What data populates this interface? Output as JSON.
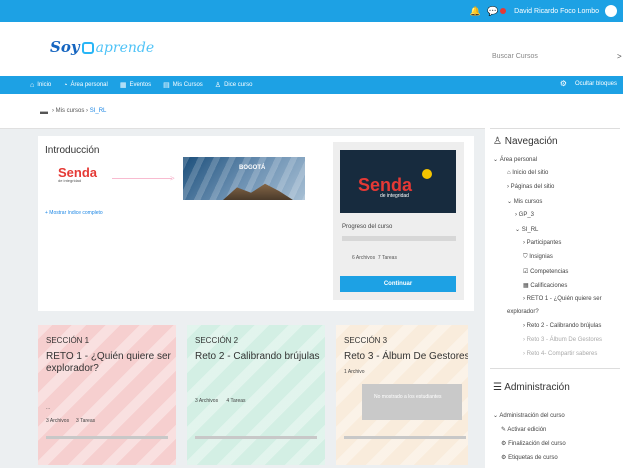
{
  "topbar": {
    "bell_icon": "bell-icon",
    "chat_icon": "chat-icon",
    "user_name": "David Ricardo Foco Lombo"
  },
  "header": {
    "logo_main": "Soy",
    "logo_sub": "aprende",
    "search_placeholder": "Buscar Cursos"
  },
  "nav": {
    "items": [
      "Inicio",
      "Área personal",
      "Eventos",
      "Mis Cursos",
      "Dice curso"
    ],
    "hide_blocks": "Ocultar bloques"
  },
  "breadcrumb": {
    "item1": "Mis cursos",
    "item2": "SI_RL"
  },
  "intro": {
    "title": "Introducción",
    "logo_text": "Senda",
    "logo_tag": "de integridad",
    "banner_text": "BOGOTÁ",
    "show_index": "+ Mostrar índice completo"
  },
  "course_card": {
    "logo_text": "Senda",
    "logo_tag": "de integridad",
    "progress_label": "Progreso del curso",
    "progress": 0.0,
    "files": "6 Archivos",
    "tasks": "7 Tareas",
    "continue": "Continuar"
  },
  "sections": [
    {
      "label": "SECCIÓN 1",
      "name": "RETO 1 - ¿Quién quiere ser explorador?",
      "files": "3 Archivos",
      "tasks": "3 Tareas",
      "dots": "..."
    },
    {
      "label": "SECCIÓN 2",
      "name": "Reto 2 - Calibrando brújulas",
      "files": "3 Archivos",
      "tasks": "4 Tareas"
    },
    {
      "label": "SECCIÓN 3",
      "name": "Reto 3 - Álbum De Gestores",
      "files": "1 Archivo",
      "hidden": "No mostrado a los estudiantes"
    }
  ],
  "navigation": {
    "title": "Navegación",
    "area": "Área personal",
    "home": "Inicio del sitio",
    "pages": "Páginas del sitio",
    "my_courses": "Mis cursos",
    "gp3": "GP_3",
    "sirl": "SI_RL",
    "participants": "Participantes",
    "badges": "Insignias",
    "competencies": "Competencias",
    "grades": "Calificaciones",
    "reto1": "RETO 1 - ¿Quién quiere ser",
    "reto1b": "explorador?",
    "reto2": "Reto 2 - Calibrando brújulas",
    "reto3": "Reto 3 - Álbum De Gestores",
    "reto4": "Reto 4- Compartir saberes"
  },
  "admin": {
    "title": "Administración",
    "course_admin": "Administración del curso",
    "edit": "Activar edición",
    "completion": "Finalización del curso",
    "tags": "Etiquetas de curso"
  }
}
